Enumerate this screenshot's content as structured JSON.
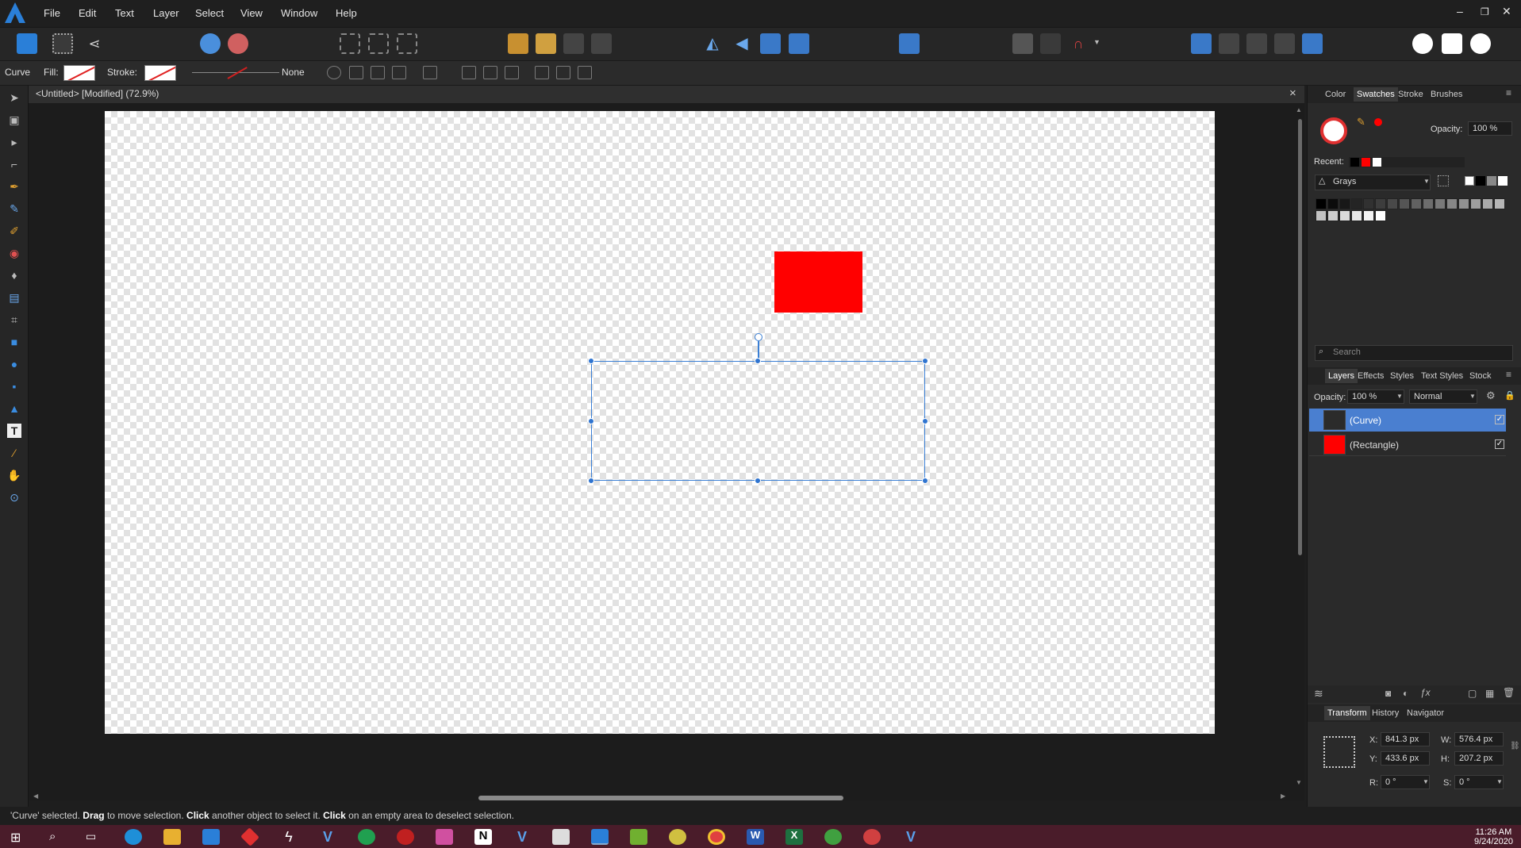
{
  "menubar": {
    "items": [
      "File",
      "Edit",
      "Text",
      "Layer",
      "Select",
      "View",
      "Window",
      "Help"
    ]
  },
  "window_controls": {
    "minimize": "–",
    "restore": "❐",
    "close": "✕"
  },
  "context": {
    "tool": "Curve",
    "fill_label": "Fill:",
    "stroke_label": "Stroke:",
    "stroke_style": "None"
  },
  "document": {
    "tab_title": "<Untitled> [Modified] (72.9%)",
    "close": "×"
  },
  "status": {
    "p1": "'Curve' selected. ",
    "b1": "Drag",
    "p2": " to move selection. ",
    "b2": "Click",
    "p3": " another object to select it. ",
    "b3": "Click",
    "p4": " on an empty area to deselect selection."
  },
  "swatches_panel": {
    "tabs": [
      "Color",
      "Swatches",
      "Stroke",
      "Brushes"
    ],
    "active_tab": "Swatches",
    "opacity_label": "Opacity:",
    "opacity_value": "100 %",
    "recent_label": "Recent:",
    "palette": "Grays",
    "search_placeholder": "Search"
  },
  "layers_panel": {
    "tabs": [
      "Layers",
      "Effects",
      "Styles",
      "Text Styles",
      "Stock"
    ],
    "opacity_label": "Opacity:",
    "opacity_value": "100 %",
    "blend_mode": "Normal",
    "layers": [
      {
        "name": "(Curve)",
        "selected": true,
        "color": "#2b2b2b"
      },
      {
        "name": "(Rectangle)",
        "selected": false,
        "color": "#ff0000"
      }
    ]
  },
  "transform_panel": {
    "tabs": [
      "Transform",
      "History",
      "Navigator"
    ],
    "x_label": "X:",
    "x": "841.3 px",
    "y_label": "Y:",
    "y": "433.6 px",
    "w_label": "W:",
    "w": "576.4 px",
    "h_label": "H:",
    "h": "207.2 px",
    "r_label": "R:",
    "r": "0 °",
    "s_label": "S:",
    "s": "0 °"
  },
  "taskbar": {
    "time": "11:26 AM",
    "date": "9/24/2020"
  },
  "colors": {
    "accent": "#2f74d0",
    "shape_fill": "#ff0000",
    "selected_layer": "#4a7fd0"
  }
}
